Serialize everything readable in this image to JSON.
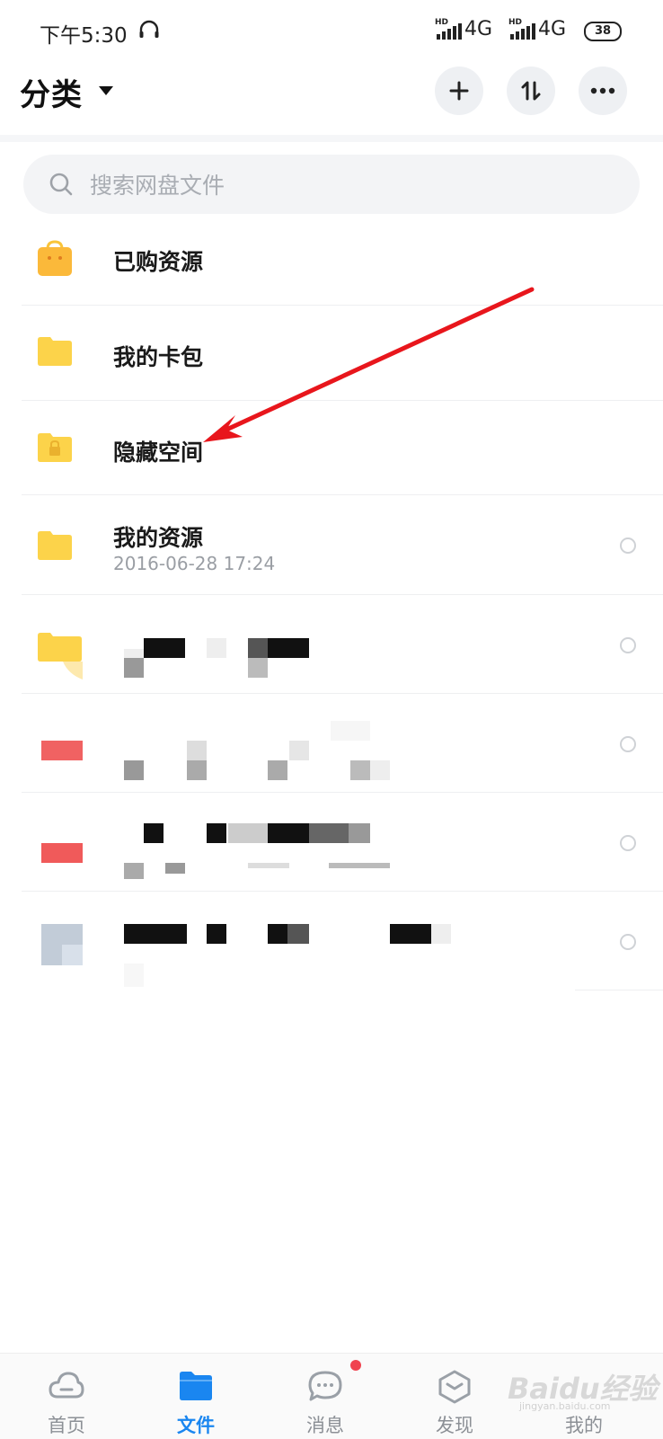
{
  "status_bar": {
    "time": "下午5:30",
    "network1": "4G",
    "network2": "4G",
    "hd1": "HD",
    "hd2": "HD",
    "battery": "38"
  },
  "header": {
    "title": "分类"
  },
  "search": {
    "placeholder": "搜索网盘文件"
  },
  "items": [
    {
      "name": "已购资源",
      "icon": "shopping-bag-folder-icon"
    },
    {
      "name": "我的卡包",
      "icon": "folder-icon"
    },
    {
      "name": "隐藏空间",
      "icon": "locked-folder-icon"
    },
    {
      "name": "我的资源",
      "date": "2016-06-28  17:24",
      "icon": "folder-icon"
    }
  ],
  "bottom_nav": [
    {
      "label": "首页",
      "icon": "cloud-icon",
      "active": false
    },
    {
      "label": "文件",
      "icon": "folder-icon",
      "active": true
    },
    {
      "label": "消息",
      "icon": "chat-icon",
      "active": false
    },
    {
      "label": "发现",
      "icon": "discover-icon",
      "active": false
    },
    {
      "label": "我的",
      "icon": "profile-icon",
      "active": false
    }
  ],
  "watermark": {
    "text": "Baidu经验",
    "sub": "jingyan.baidu.com"
  },
  "colors": {
    "accent": "#1a86f0",
    "folder": "#fcd34a",
    "badge": "#f0424f",
    "arrow": "#e8161c"
  }
}
